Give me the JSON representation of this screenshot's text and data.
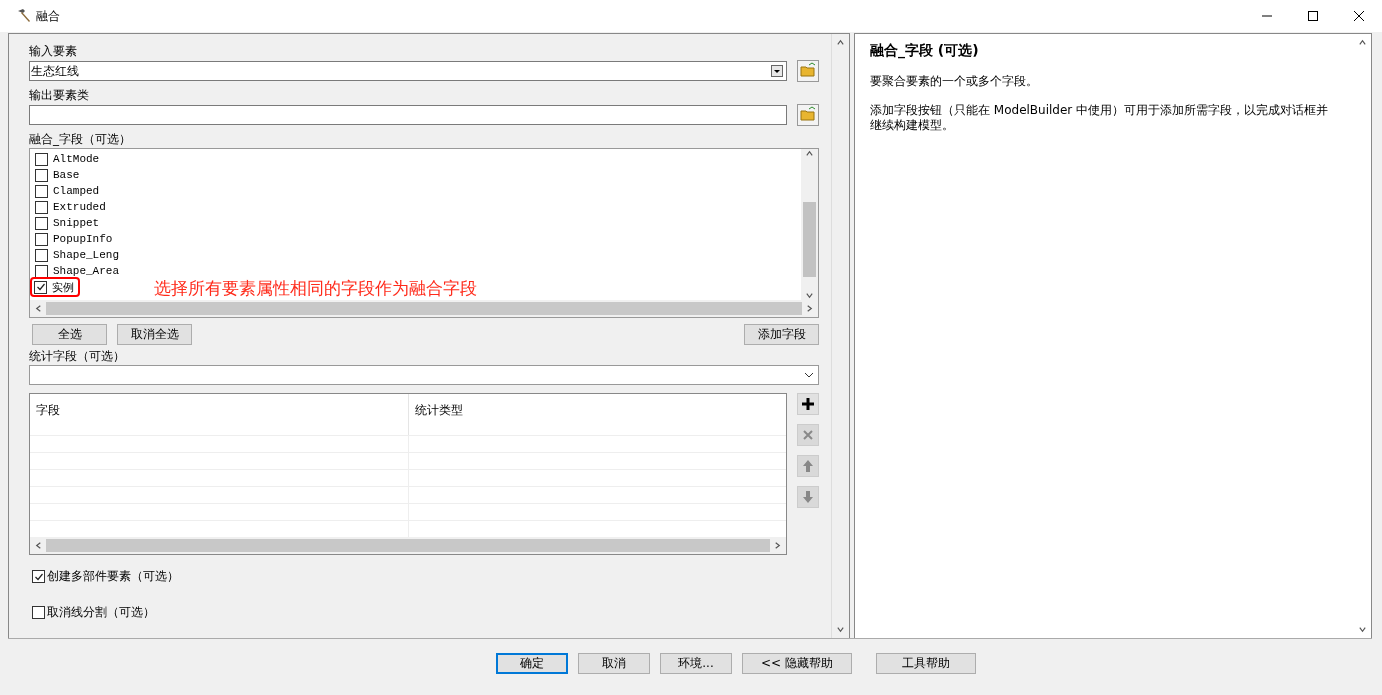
{
  "window": {
    "title": "融合"
  },
  "form": {
    "input_label": "输入要素",
    "input_value": "生态红线",
    "output_label": "输出要素类",
    "dissolve_label": "融合_字段（可选）",
    "fields": [
      {
        "name": "AltMode",
        "checked": false,
        "highlighted": false
      },
      {
        "name": "Base",
        "checked": false,
        "highlighted": false
      },
      {
        "name": "Clamped",
        "checked": false,
        "highlighted": false
      },
      {
        "name": "Extruded",
        "checked": false,
        "highlighted": false
      },
      {
        "name": "Snippet",
        "checked": false,
        "highlighted": false
      },
      {
        "name": "PopupInfo",
        "checked": false,
        "highlighted": false
      },
      {
        "name": "Shape_Leng",
        "checked": false,
        "highlighted": false
      },
      {
        "name": "Shape_Area",
        "checked": false,
        "highlighted": false
      },
      {
        "name": "实例",
        "checked": true,
        "highlighted": true
      }
    ],
    "annotation": "选择所有要素属性相同的字段作为融合字段",
    "list_buttons": [
      "全选",
      "取消全选"
    ],
    "add_field_button": "添加字段",
    "stats_label": "统计字段（可选）",
    "stats_columns": [
      "字段",
      "统计类型"
    ],
    "side_buttons": [
      {
        "kind": "add",
        "disabled": false
      },
      {
        "kind": "delete",
        "disabled": true
      },
      {
        "kind": "up",
        "disabled": true
      },
      {
        "kind": "down",
        "disabled": true
      }
    ],
    "options": [
      {
        "label": "创建多部件要素（可选）",
        "checked": true
      },
      {
        "label": "取消线分割（可选）",
        "checked": false
      }
    ]
  },
  "help": {
    "title": "融合_字段 (可选)",
    "paragraphs": [
      "要聚合要素的一个或多个字段。",
      "添加字段按钮（只能在 ModelBuilder 中使用）可用于添加所需字段，以完成对话框并继续构建模型。"
    ]
  },
  "buttons": [
    {
      "label": "确定",
      "default": true
    },
    {
      "label": "取消",
      "default": false
    },
    {
      "label": "环境...",
      "default": false
    },
    {
      "label": "<< 隐藏帮助",
      "default": false
    },
    {
      "label": "工具帮助",
      "default": false
    }
  ]
}
